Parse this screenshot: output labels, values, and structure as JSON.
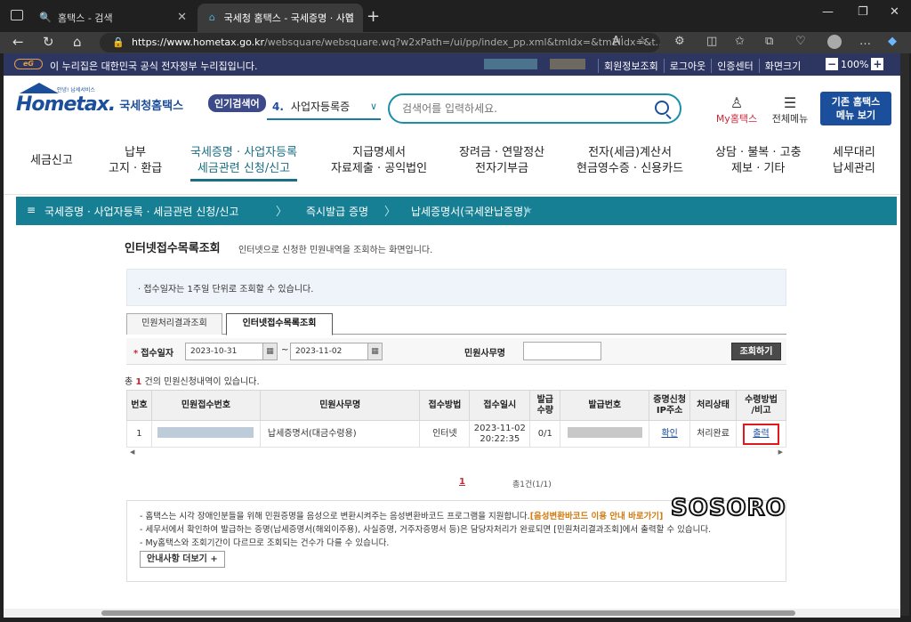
{
  "browser": {
    "tabs": [
      {
        "title": "홈택스 - 검색"
      },
      {
        "title": "국세청 홈택스 - 국세증명 · 사업"
      }
    ],
    "url_host": "https://www.hometax.go.kr",
    "url_path": "/websquare/websquare.wq?w2xPath=/ui/pp/index_pp.xml&tmIdx=&tm2lIdx=&t..."
  },
  "govbar": {
    "message": "이 누리집은 대한민국 공식 전자정부 누리집입니다.",
    "logo": "eG",
    "links": [
      "회원정보조회",
      "로그아웃",
      "인증센터",
      "화면크기"
    ],
    "zoom": "100%",
    "zoom_minus": "−",
    "zoom_plus": "+"
  },
  "header": {
    "brand": "Hometax.",
    "brand_kr": "국세청홈택스",
    "brand_small": "안녕! 납세서비스",
    "popular_label": "인기검색어",
    "popular_rank": "4.",
    "popular_term": "사업자등록증",
    "search_placeholder": "검색어를 입력하세요.",
    "my_label": "My홈택스",
    "allmenu_label": "전체메뉴",
    "old_button": [
      "기존 홈택스",
      "메뉴 보기"
    ]
  },
  "gnb": [
    {
      "l1": "세금신고",
      "l2": ""
    },
    {
      "l1": "납부",
      "l2": "고지 · 환급"
    },
    {
      "l1": "국세증명 · 사업자등록",
      "l2": "세금관련 신청/신고"
    },
    {
      "l1": "지급명세서",
      "l2": "자료제출 · 공익법인"
    },
    {
      "l1": "장려금 · 연말정산",
      "l2": "전자기부금"
    },
    {
      "l1": "전자(세금)계산서",
      "l2": "현금영수증 · 신용카드"
    },
    {
      "l1": "상담 · 불복 · 고충",
      "l2": "제보 · 기타"
    },
    {
      "l1": "세무대리",
      "l2": "납세관리"
    }
  ],
  "breadcrumb": [
    "국세증명 · 사업자등록 · 세금관련 신청/신고",
    "즉시발급 증명",
    "납세증명서(국세완납증명)"
  ],
  "page": {
    "title": "인터넷접수목록조회",
    "desc": "인터넷으로 신청한 민원내역을 조회하는 화면입니다.",
    "notice": "· 접수일자는 1주일 단위로 조회할 수 있습니다.",
    "tabs": [
      "민원처리결과조회",
      "인터넷접수목록조회"
    ]
  },
  "filter": {
    "date_label": "접수일자",
    "date_from": "2023-10-31",
    "date_to": "2023-11-02",
    "tilde": "~",
    "doc_label": "민원사무명",
    "doc_value": "",
    "search_button": "조회하기"
  },
  "result": {
    "prefix": "총",
    "count": "1",
    "suffix": "건의 민원신청내역이 있습니다."
  },
  "table": {
    "headers": [
      "번호",
      "민원접수번호",
      "민원사무명",
      "접수방법",
      "접수일시",
      "발급\n수량",
      "발급번호",
      "증명신청\nIP주소",
      "처리상태",
      "수령방법\n/비고"
    ],
    "rows": [
      {
        "no": "1",
        "doc": "납세증명서(대금수령용)",
        "method": "인터넷",
        "date": "2023-11-02",
        "time": "20:22:35",
        "qty": "0/1",
        "ip": "확인",
        "status": "처리완료",
        "action": "출력"
      }
    ]
  },
  "pager": {
    "current": "1",
    "summary": "총1건(1/1)"
  },
  "info": {
    "lines": [
      "- 홈택스는 시각 장애인분들을 위해 민원증명을 음성으로 변환시켜주는 음성변환바코드 프로그램을 지원합니다.",
      "- 세무서에서 확인하여 발급하는 증명(납세증명서(해외이주용), 사실증명, 거주자증명서 등)은 담당자처리가 완료되면 [민원처리결과조회]에서 출력할 수 있습니다.",
      "- My홈택스와 조회기간이 다르므로 조회되는 건수가 다를 수 있습니다."
    ],
    "highlight": "[음성변환바코드 이용 안내 바로가기]",
    "more_button": "안내사항 더보기 +"
  },
  "watermark": "SOSORO"
}
